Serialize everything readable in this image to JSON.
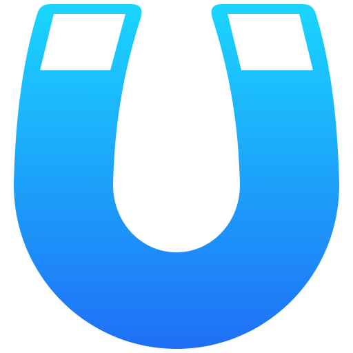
{
  "icon": {
    "name": "magnet-icon",
    "colors": {
      "gradient_top": "#1ad6ff",
      "gradient_bottom": "#1f6ff5",
      "pole_fill": "#ffffff",
      "background": "#ffffff"
    }
  }
}
